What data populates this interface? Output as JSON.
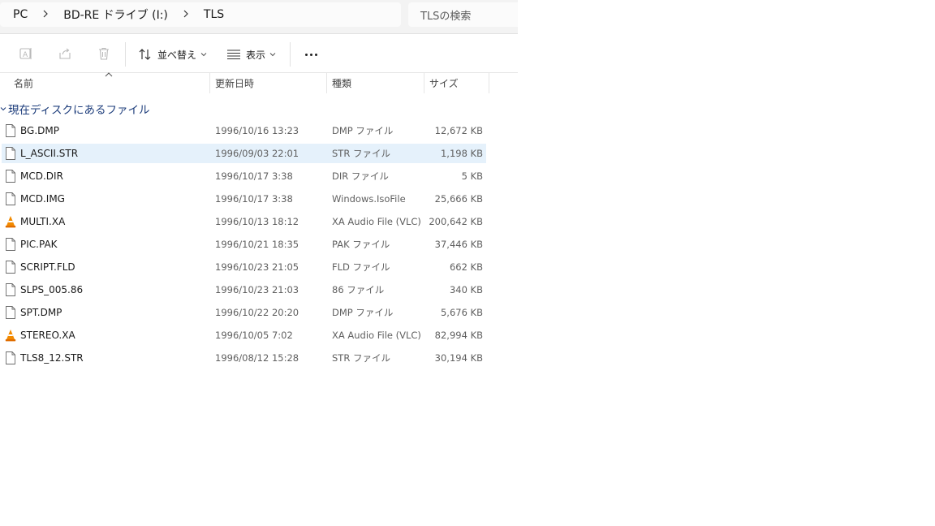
{
  "breadcrumb": [
    "PC",
    "BD-RE ドライブ (I:)",
    "TLS"
  ],
  "search": {
    "placeholder": "TLSの検索"
  },
  "toolbar": {
    "sort_label": "並べ替え",
    "view_label": "表示"
  },
  "columns": {
    "name": "名前",
    "date": "更新日時",
    "type": "種類",
    "size": "サイズ"
  },
  "group_label": "現在ディスクにあるファイル",
  "colors": {
    "selection": "#e5f1fb",
    "group_text": "#1b3b7a",
    "vlc_orange": "#f28a00"
  },
  "files": [
    {
      "name": "BG.DMP",
      "date": "1996/10/16 13:23",
      "type": "DMP ファイル",
      "size": "12,672 KB",
      "icon": "file-icon",
      "selected": false
    },
    {
      "name": "L_ASCII.STR",
      "date": "1996/09/03 22:01",
      "type": "STR ファイル",
      "size": "1,198 KB",
      "icon": "file-icon",
      "selected": true
    },
    {
      "name": "MCD.DIR",
      "date": "1996/10/17 3:38",
      "type": "DIR ファイル",
      "size": "5 KB",
      "icon": "file-icon",
      "selected": false
    },
    {
      "name": "MCD.IMG",
      "date": "1996/10/17 3:38",
      "type": "Windows.IsoFile",
      "size": "25,666 KB",
      "icon": "file-icon",
      "selected": false
    },
    {
      "name": "MULTI.XA",
      "date": "1996/10/13 18:12",
      "type": "XA Audio File (VLC)",
      "size": "200,642 KB",
      "icon": "vlc-cone-icon",
      "selected": false
    },
    {
      "name": "PIC.PAK",
      "date": "1996/10/21 18:35",
      "type": "PAK ファイル",
      "size": "37,446 KB",
      "icon": "file-icon",
      "selected": false
    },
    {
      "name": "SCRIPT.FLD",
      "date": "1996/10/23 21:05",
      "type": "FLD ファイル",
      "size": "662 KB",
      "icon": "file-icon",
      "selected": false
    },
    {
      "name": "SLPS_005.86",
      "date": "1996/10/23 21:03",
      "type": "86 ファイル",
      "size": "340 KB",
      "icon": "file-icon",
      "selected": false
    },
    {
      "name": "SPT.DMP",
      "date": "1996/10/22 20:20",
      "type": "DMP ファイル",
      "size": "5,676 KB",
      "icon": "file-icon",
      "selected": false
    },
    {
      "name": "STEREO.XA",
      "date": "1996/10/05 7:02",
      "type": "XA Audio File (VLC)",
      "size": "82,994 KB",
      "icon": "vlc-cone-icon",
      "selected": false
    },
    {
      "name": "TLS8_12.STR",
      "date": "1996/08/12 15:28",
      "type": "STR ファイル",
      "size": "30,194 KB",
      "icon": "file-icon",
      "selected": false
    }
  ]
}
